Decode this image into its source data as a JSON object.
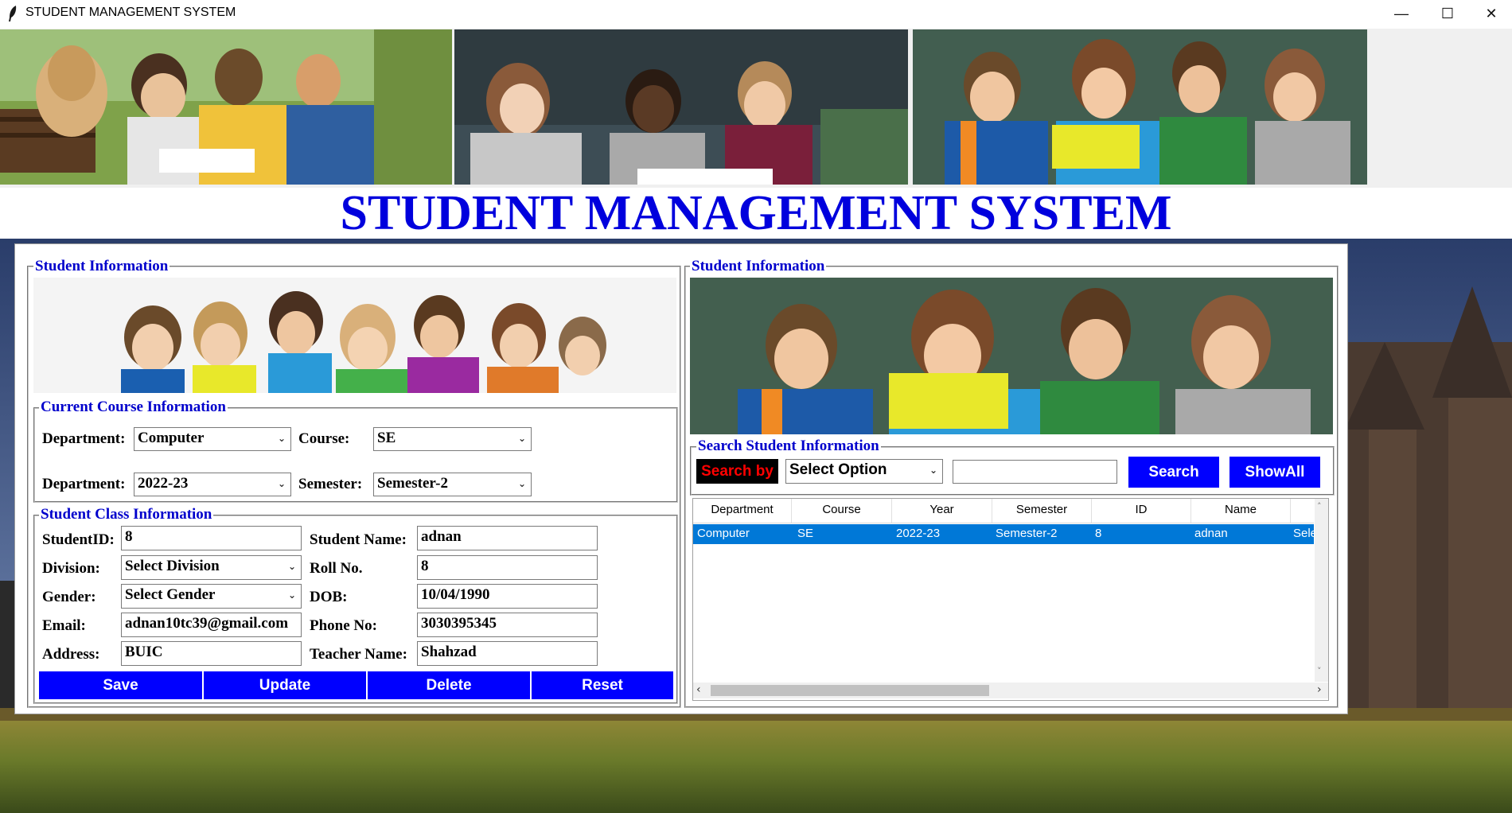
{
  "window": {
    "title": "STUDENT MANAGEMENT SYSTEM",
    "minimize": "—",
    "maximize": "☐",
    "close": "✕"
  },
  "heading": "STUDENT MANAGEMENT SYSTEM",
  "left": {
    "frame_label": "Student Information",
    "course": {
      "label": "Current Course Information",
      "department_label": "Department:",
      "department_value": "Computer",
      "course_label": "Course:",
      "course_value": "SE",
      "year_label": "Department:",
      "year_value": "2022-23",
      "semester_label": "Semester:",
      "semester_value": "Semester-2"
    },
    "class": {
      "label": "Student Class Information",
      "studentid_label": "StudentID:",
      "studentid_value": "8",
      "name_label": "Student Name:",
      "name_value": "adnan",
      "division_label": "Division:",
      "division_value": "Select Division",
      "roll_label": "Roll No.",
      "roll_value": "8",
      "gender_label": "Gender:",
      "gender_value": "Select Gender",
      "dob_label": "DOB:",
      "dob_value": "10/04/1990",
      "email_label": "Email:",
      "email_value": "adnan10tc39@gmail.com",
      "phone_label": "Phone No:",
      "phone_value": "3030395345",
      "address_label": "Address:",
      "address_value": "BUIC",
      "teacher_label": "Teacher Name:",
      "teacher_value": "Shahzad"
    },
    "buttons": {
      "save": "Save",
      "update": "Update",
      "delete": "Delete",
      "reset": "Reset"
    }
  },
  "right": {
    "frame_label": "Student Information",
    "search": {
      "label": "Search Student Information",
      "search_by": "Search by",
      "option_value": "Select Option",
      "search_text": "",
      "search_button": "Search",
      "showall_button": "ShowAll"
    },
    "table": {
      "columns": [
        "Department",
        "Course",
        "Year",
        "Semester",
        "ID",
        "Name"
      ],
      "rows": [
        [
          "Computer",
          "SE",
          "2022-23",
          "Semester-2",
          "8",
          "adnan",
          "Sele"
        ]
      ]
    }
  },
  "colors": {
    "heading": "#0000dd",
    "button": "#0000ff",
    "search_by_bg": "#000000",
    "search_by_fg": "#ff0000",
    "selected_row": "#0078d7"
  }
}
